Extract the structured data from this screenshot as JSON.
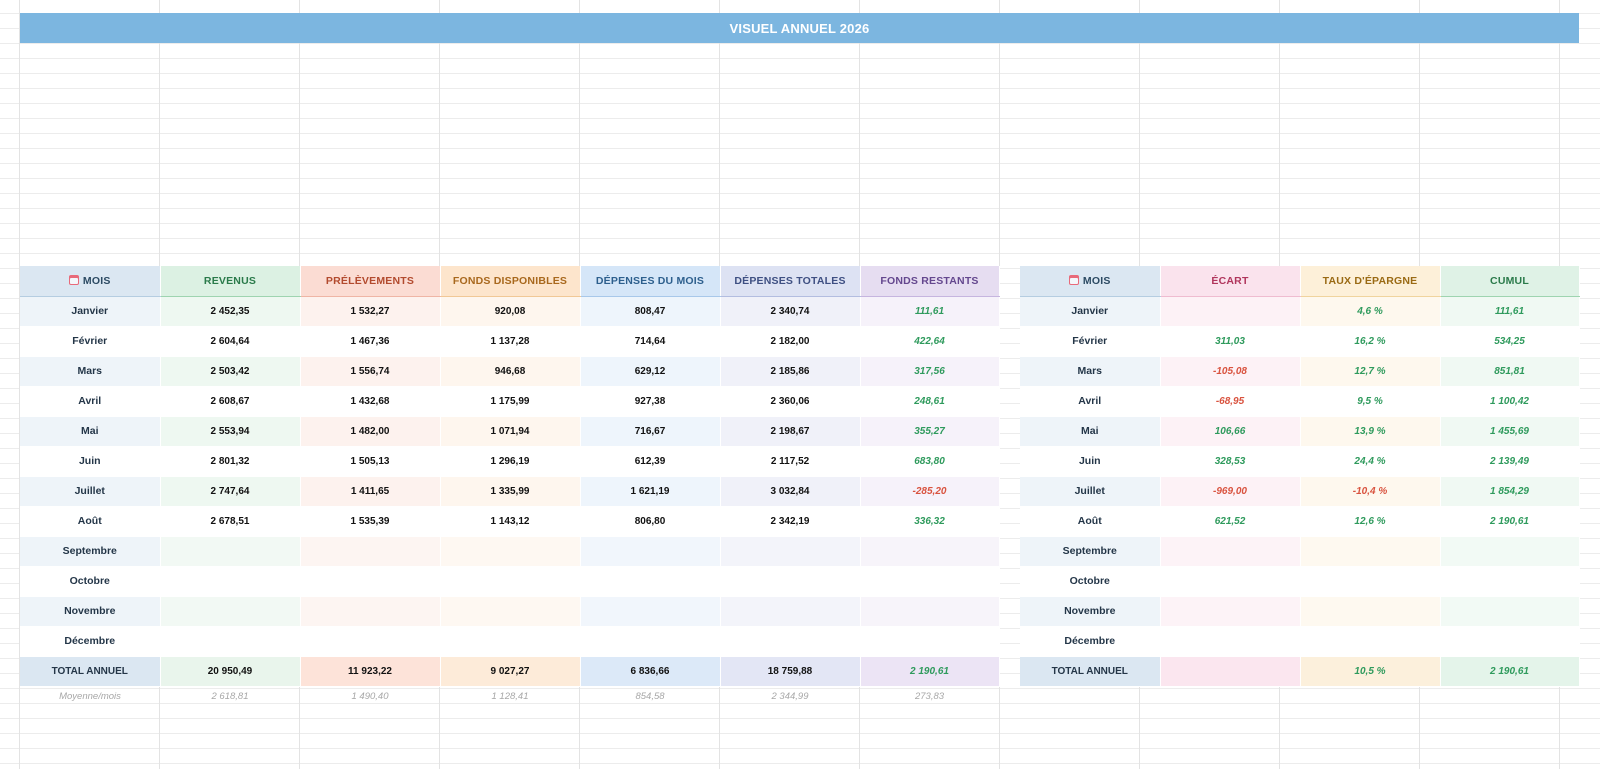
{
  "title": "VISUEL ANNUEL 2026",
  "colors": {
    "banner": "#7cb6e0",
    "positive": "#2e9a5c",
    "negative": "#d9533f"
  },
  "left_table": {
    "headers": [
      "MOIS",
      "REVENUS",
      "PRÉLÈVEMENTS",
      "FONDS DISPONIBLES",
      "DÉPENSES DU MOIS",
      "DÉPENSES TOTALES",
      "FONDS RESTANTS"
    ],
    "header_icon": "calendar-icon",
    "rows": [
      [
        "Janvier",
        "2 452,35",
        "1 532,27",
        "920,08",
        "808,47",
        "2 340,74",
        "111,61"
      ],
      [
        "Février",
        "2 604,64",
        "1 467,36",
        "1 137,28",
        "714,64",
        "2 182,00",
        "422,64"
      ],
      [
        "Mars",
        "2 503,42",
        "1 556,74",
        "946,68",
        "629,12",
        "2 185,86",
        "317,56"
      ],
      [
        "Avril",
        "2 608,67",
        "1 432,68",
        "1 175,99",
        "927,38",
        "2 360,06",
        "248,61"
      ],
      [
        "Mai",
        "2 553,94",
        "1 482,00",
        "1 071,94",
        "716,67",
        "2 198,67",
        "355,27"
      ],
      [
        "Juin",
        "2 801,32",
        "1 505,13",
        "1 296,19",
        "612,39",
        "2 117,52",
        "683,80"
      ],
      [
        "Juillet",
        "2 747,64",
        "1 411,65",
        "1 335,99",
        "1 621,19",
        "3 032,84",
        "-285,20"
      ],
      [
        "Août",
        "2 678,51",
        "1 535,39",
        "1 143,12",
        "806,80",
        "2 342,19",
        "336,32"
      ],
      [
        "Septembre",
        "",
        "",
        "",
        "",
        "",
        ""
      ],
      [
        "Octobre",
        "",
        "",
        "",
        "",
        "",
        ""
      ],
      [
        "Novembre",
        "",
        "",
        "",
        "",
        "",
        ""
      ],
      [
        "Décembre",
        "",
        "",
        "",
        "",
        "",
        ""
      ]
    ],
    "total": [
      "TOTAL ANNUEL",
      "20 950,49",
      "11 923,22",
      "9 027,27",
      "6 836,66",
      "18 759,88",
      "2 190,61"
    ],
    "average": [
      "Moyenne/mois",
      "2 618,81",
      "1 490,40",
      "1 128,41",
      "854,58",
      "2 344,99",
      "273,83"
    ]
  },
  "right_table": {
    "headers": [
      "MOIS",
      "ÉCART",
      "TAUX D'ÉPARGNE",
      "CUMUL"
    ],
    "header_icon": "calendar-icon",
    "rows": [
      [
        "Janvier",
        "",
        "4,6 %",
        "111,61"
      ],
      [
        "Février",
        "311,03",
        "16,2 %",
        "534,25"
      ],
      [
        "Mars",
        "-105,08",
        "12,7 %",
        "851,81"
      ],
      [
        "Avril",
        "-68,95",
        "9,5 %",
        "1 100,42"
      ],
      [
        "Mai",
        "106,66",
        "13,9 %",
        "1 455,69"
      ],
      [
        "Juin",
        "328,53",
        "24,4 %",
        "2 139,49"
      ],
      [
        "Juillet",
        "-969,00",
        "-10,4 %",
        "1 854,29"
      ],
      [
        "Août",
        "621,52",
        "12,6 %",
        "2 190,61"
      ],
      [
        "Septembre",
        "",
        "",
        ""
      ],
      [
        "Octobre",
        "",
        "",
        ""
      ],
      [
        "Novembre",
        "",
        "",
        ""
      ],
      [
        "Décembre",
        "",
        "",
        ""
      ]
    ],
    "total": [
      "TOTAL ANNUEL",
      "",
      "10,5 %",
      "2 190,61"
    ]
  }
}
